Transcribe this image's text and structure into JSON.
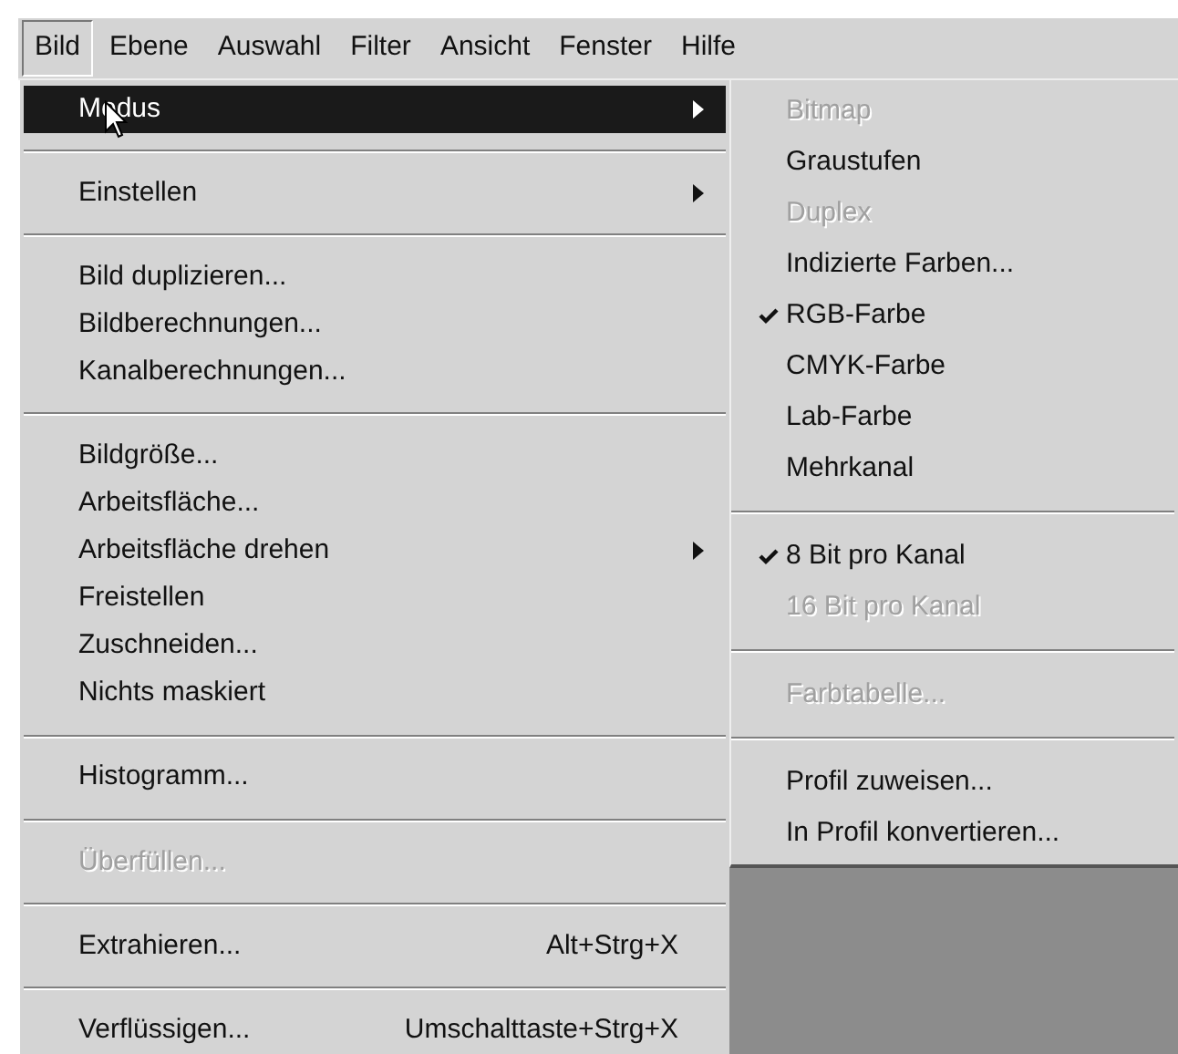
{
  "menubar": [
    {
      "label": "Bild",
      "selected": true
    },
    {
      "label": "Ebene",
      "selected": false
    },
    {
      "label": "Auswahl",
      "selected": false
    },
    {
      "label": "Filter",
      "selected": false
    },
    {
      "label": "Ansicht",
      "selected": false
    },
    {
      "label": "Fenster",
      "selected": false
    },
    {
      "label": "Hilfe",
      "selected": false
    }
  ],
  "menu": [
    {
      "kind": "item",
      "label": "Modus",
      "submenu": true,
      "selected": true,
      "disabled": false
    },
    {
      "kind": "separator"
    },
    {
      "kind": "item",
      "label": "Einstellen",
      "submenu": true,
      "selected": false,
      "disabled": false
    },
    {
      "kind": "separator"
    },
    {
      "kind": "item",
      "label": "Bild duplizieren...",
      "selected": false,
      "disabled": false
    },
    {
      "kind": "item",
      "label": "Bildberechnungen...",
      "selected": false,
      "disabled": false
    },
    {
      "kind": "item",
      "label": "Kanalberechnungen...",
      "selected": false,
      "disabled": false
    },
    {
      "kind": "separator"
    },
    {
      "kind": "item",
      "label": "Bildgröße...",
      "selected": false,
      "disabled": false
    },
    {
      "kind": "item",
      "label": "Arbeitsfläche...",
      "selected": false,
      "disabled": false
    },
    {
      "kind": "item",
      "label": "Arbeitsfläche drehen",
      "submenu": true,
      "selected": false,
      "disabled": false
    },
    {
      "kind": "item",
      "label": "Freistellen",
      "selected": false,
      "disabled": false
    },
    {
      "kind": "item",
      "label": "Zuschneiden...",
      "selected": false,
      "disabled": false
    },
    {
      "kind": "item",
      "label": "Nichts maskiert",
      "selected": false,
      "disabled": false
    },
    {
      "kind": "separator"
    },
    {
      "kind": "item",
      "label": "Histogramm...",
      "selected": false,
      "disabled": false
    },
    {
      "kind": "separator"
    },
    {
      "kind": "item",
      "label": "Überfüllen...",
      "selected": false,
      "disabled": true
    },
    {
      "kind": "separator"
    },
    {
      "kind": "item",
      "label": "Extrahieren...",
      "shortcut": "Alt+Strg+X",
      "selected": false,
      "disabled": false
    },
    {
      "kind": "separator"
    },
    {
      "kind": "item",
      "label": "Verflüssigen...",
      "shortcut": "Umschalttaste+Strg+X",
      "selected": false,
      "disabled": false
    }
  ],
  "submenu": [
    {
      "kind": "item",
      "label": "Bitmap",
      "checked": false,
      "disabled": true
    },
    {
      "kind": "item",
      "label": "Graustufen",
      "checked": false,
      "disabled": false
    },
    {
      "kind": "item",
      "label": "Duplex",
      "checked": false,
      "disabled": true
    },
    {
      "kind": "item",
      "label": "Indizierte Farben...",
      "checked": false,
      "disabled": false
    },
    {
      "kind": "item",
      "label": "RGB-Farbe",
      "checked": true,
      "disabled": false
    },
    {
      "kind": "item",
      "label": "CMYK-Farbe",
      "checked": false,
      "disabled": false
    },
    {
      "kind": "item",
      "label": "Lab-Farbe",
      "checked": false,
      "disabled": false
    },
    {
      "kind": "item",
      "label": "Mehrkanal",
      "checked": false,
      "disabled": false
    },
    {
      "kind": "separator"
    },
    {
      "kind": "item",
      "label": "8 Bit pro Kanal",
      "checked": true,
      "disabled": false
    },
    {
      "kind": "item",
      "label": "16 Bit pro Kanal",
      "checked": false,
      "disabled": true
    },
    {
      "kind": "separator"
    },
    {
      "kind": "item",
      "label": "Farbtabelle...",
      "checked": false,
      "disabled": true
    },
    {
      "kind": "separator"
    },
    {
      "kind": "item",
      "label": "Profil zuweisen...",
      "checked": false,
      "disabled": false
    },
    {
      "kind": "item",
      "label": "In Profil konvertieren...",
      "checked": false,
      "disabled": false
    }
  ]
}
